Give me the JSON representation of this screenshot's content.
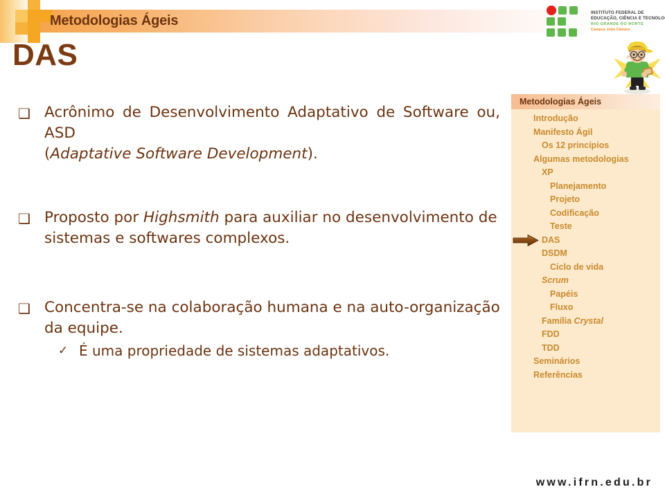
{
  "header": {
    "banner_title": "Metodologias Ágeis",
    "slide_title": "DAS"
  },
  "logo": {
    "line1": "INSTITUTO FEDERAL DE",
    "line2": "EDUCAÇÃO, CIÊNCIA E TECNOLOGIA",
    "line3": "RIO GRANDE DO NORTE",
    "line4": "Campus João Câmara",
    "green": "#5fb64a",
    "red": "#e2201c",
    "orange": "#f08a1c"
  },
  "content": {
    "bullets": [
      {
        "marker": "❑",
        "line1": "Acrônimo de Desenvolvimento Adaptativo de Software ou, ASD",
        "line2_pre": "(",
        "line2_em": "Adaptative Software Development",
        "line2_post": ")."
      },
      {
        "marker": "❑",
        "line1_pre": "Proposto por ",
        "line1_em": "Highsmith",
        "line1_post": " para auxiliar no desenvolvimento de",
        "line2": "sistemas e softwares complexos."
      },
      {
        "marker": "❑",
        "line1": "Concentra-se na colaboração humana e na auto-organização",
        "line2": "da equipe.",
        "sub_marker": "✓",
        "sub_text": "É uma propriedade de sistemas adaptativos."
      }
    ]
  },
  "sidebar": {
    "title": "Metodologias Ágeis",
    "active_item": "DAS",
    "accent_color": "#c88a2e",
    "background": "#fdeacc",
    "items": [
      {
        "label": "Introdução",
        "level": 0,
        "italic": false
      },
      {
        "label": "Manifesto Ágil",
        "level": 0,
        "italic": false
      },
      {
        "label": "Os 12 princípios",
        "level": 1,
        "italic": false
      },
      {
        "label": "Algumas metodologias",
        "level": 0,
        "italic": false
      },
      {
        "label": "XP",
        "level": 1,
        "italic": false
      },
      {
        "label": "Planejamento",
        "level": 2,
        "italic": false
      },
      {
        "label": "Projeto",
        "level": 2,
        "italic": false
      },
      {
        "label": "Codificação",
        "level": 2,
        "italic": false
      },
      {
        "label": "Teste",
        "level": 2,
        "italic": false
      },
      {
        "label": "DAS",
        "level": 1,
        "italic": false
      },
      {
        "label": "DSDM",
        "level": 1,
        "italic": false
      },
      {
        "label": "Ciclo de vida",
        "level": 2,
        "italic": false
      },
      {
        "label": "Scrum",
        "level": 1,
        "italic": true
      },
      {
        "label": "Papéis",
        "level": 2,
        "italic": false
      },
      {
        "label": "Fluxo",
        "level": 2,
        "italic": false
      },
      {
        "label": "Família Crystal",
        "level": 1,
        "italic": false
      },
      {
        "label": "FDD",
        "level": 1,
        "italic": false
      },
      {
        "label": "TDD",
        "level": 1,
        "italic": false
      },
      {
        "label": "Seminários",
        "level": 0,
        "italic": false
      },
      {
        "label": "Referências",
        "level": 0,
        "italic": false
      }
    ]
  },
  "footer": {
    "url": "www.ifrn.edu.br"
  }
}
